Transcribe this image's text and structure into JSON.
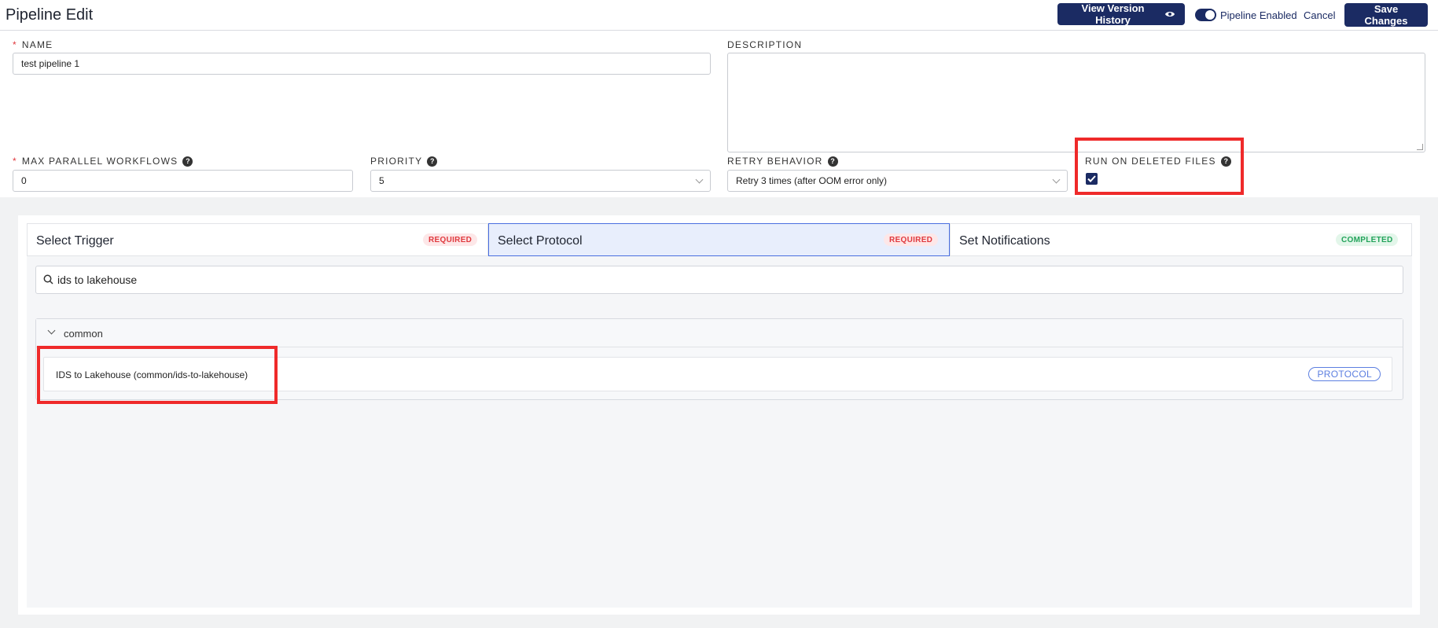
{
  "header": {
    "title": "Pipeline Edit",
    "view_history_label": "View Version History",
    "pipeline_enabled_label": "Pipeline Enabled",
    "pipeline_enabled": true,
    "cancel_label": "Cancel",
    "save_label": "Save Changes"
  },
  "form": {
    "name": {
      "label": "NAME",
      "value": "test pipeline 1",
      "required": true
    },
    "description": {
      "label": "DESCRIPTION",
      "value": ""
    },
    "max_parallel": {
      "label": "MAX PARALLEL WORKFLOWS",
      "value": "0",
      "required": true
    },
    "priority": {
      "label": "PRIORITY",
      "value": "5"
    },
    "retry": {
      "label": "RETRY BEHAVIOR",
      "value": "Retry 3 times (after OOM error only)"
    },
    "run_on_deleted": {
      "label": "RUN ON DELETED FILES",
      "checked": true
    }
  },
  "tabs": [
    {
      "label": "Select Trigger",
      "badge": "REQUIRED",
      "status": "required",
      "active": false
    },
    {
      "label": "Select Protocol",
      "badge": "REQUIRED",
      "status": "required",
      "active": true
    },
    {
      "label": "Set Notifications",
      "badge": "COMPLETED",
      "status": "completed",
      "active": false
    }
  ],
  "search": {
    "value": "ids to lakehouse"
  },
  "groups": [
    {
      "name": "common",
      "items": [
        {
          "label": "IDS to Lakehouse (common/ids-to-lakehouse)",
          "tag": "PROTOCOL"
        }
      ]
    }
  ],
  "colors": {
    "primary": "#1b2b63",
    "highlight": "#ef2a2a",
    "required": "#e0393e",
    "completed": "#22a35a",
    "active_tab": "#4a6ee0"
  },
  "icons": {
    "view_history": "eye-icon",
    "help": "question-circle-icon",
    "checkbox": "check-icon",
    "search": "search-icon",
    "group_toggle": "chevron-down-icon"
  }
}
